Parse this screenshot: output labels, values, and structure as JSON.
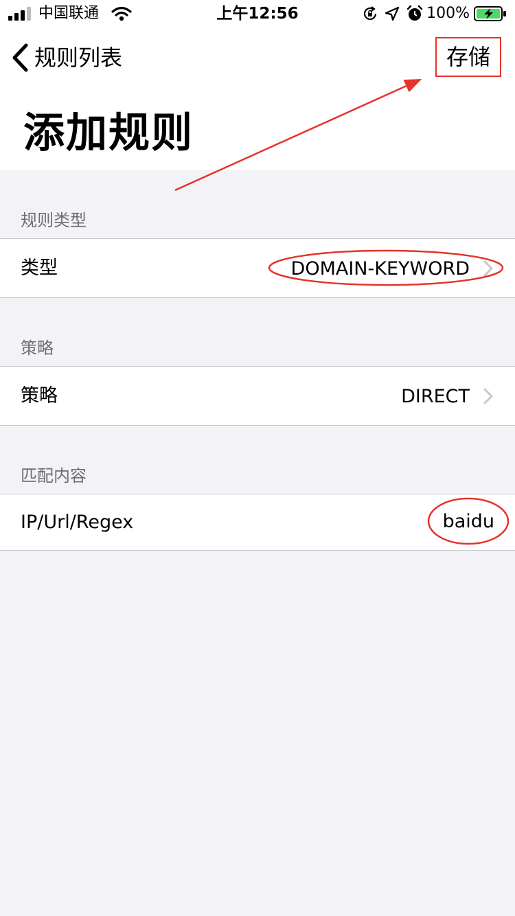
{
  "status_bar": {
    "carrier": "中国联通",
    "time": "上午12:56",
    "battery": "100%"
  },
  "nav": {
    "back_label": "规则列表",
    "save_label": "存储"
  },
  "page_title": "添加规则",
  "sections": [
    {
      "header": "规则类型",
      "label": "类型",
      "value": "DOMAIN-KEYWORD"
    },
    {
      "header": "策略",
      "label": "策略",
      "value": "DIRECT"
    },
    {
      "header": "匹配内容",
      "label": "IP/Url/Regex",
      "value": "baidu"
    }
  ],
  "colors": {
    "annotation_red": "#e5332a",
    "battery_green": "#4cd964",
    "background": "#f2f2f7"
  }
}
